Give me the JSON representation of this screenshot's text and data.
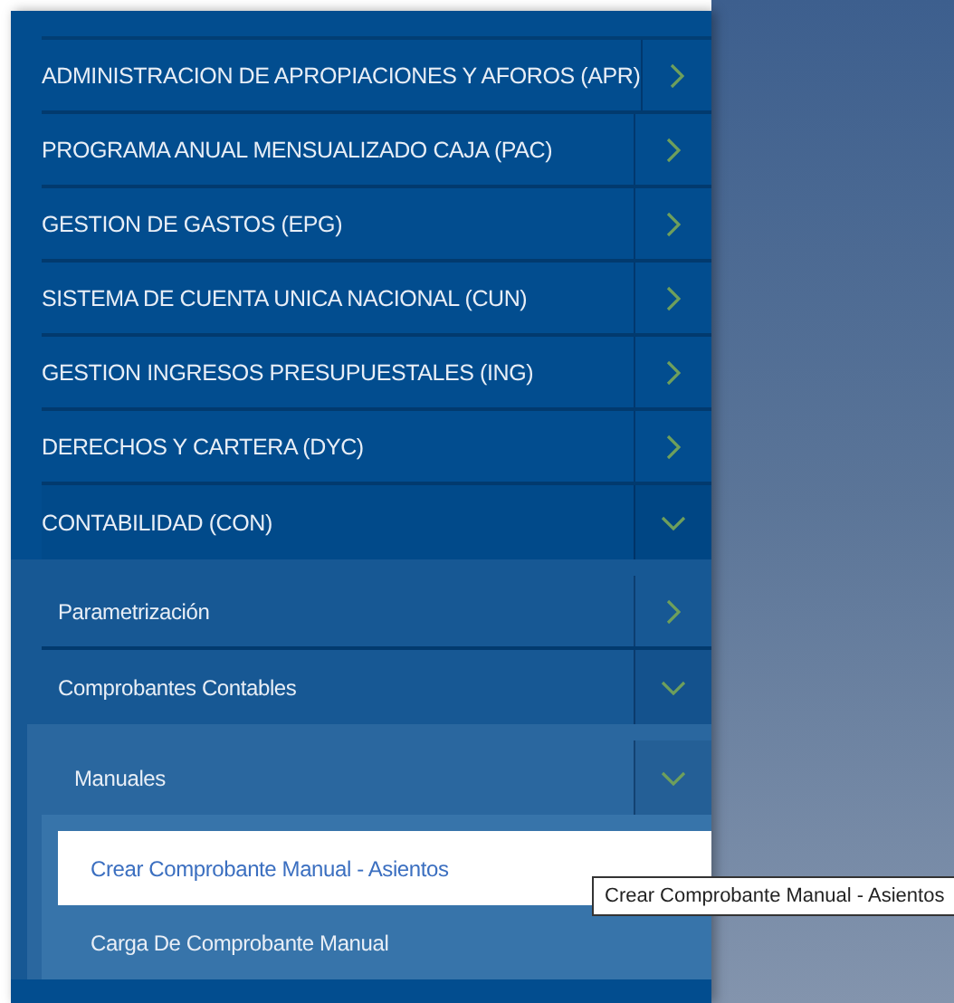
{
  "menu": {
    "items": [
      {
        "label": "ADMINISTRACION DE APROPIACIONES Y AFOROS (APR)",
        "expanded": false
      },
      {
        "label": "PROGRAMA ANUAL MENSUALIZADO CAJA (PAC)",
        "expanded": false
      },
      {
        "label": "GESTION DE GASTOS (EPG)",
        "expanded": false
      },
      {
        "label": "SISTEMA DE CUENTA UNICA NACIONAL (CUN)",
        "expanded": false
      },
      {
        "label": "GESTION INGRESOS PRESUPUESTALES (ING)",
        "expanded": false
      },
      {
        "label": "DERECHOS Y CARTERA (DYC)",
        "expanded": false
      },
      {
        "label": "CONTABILIDAD (CON)",
        "expanded": true,
        "children": [
          {
            "label": "Parametrización",
            "expanded": false
          },
          {
            "label": "Comprobantes Contables",
            "expanded": true,
            "children": [
              {
                "label": "Manuales",
                "expanded": true,
                "children": [
                  {
                    "label": "Crear Comprobante Manual - Asientos",
                    "selected": true
                  },
                  {
                    "label": "Carga De Comprobante Manual",
                    "selected": false
                  }
                ]
              }
            ]
          }
        ]
      }
    ]
  },
  "tooltip": "Crear Comprobante Manual - Asientos"
}
